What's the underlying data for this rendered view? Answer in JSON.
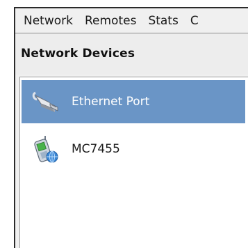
{
  "menubar": {
    "items": [
      {
        "label": "Network"
      },
      {
        "label": "Remotes"
      },
      {
        "label": "Stats"
      },
      {
        "label": "C"
      }
    ]
  },
  "panel": {
    "title": "Network Devices"
  },
  "devices": [
    {
      "label": "Ethernet Port",
      "icon": "ethernet-port-icon",
      "selected": true
    },
    {
      "label": "MC7455",
      "icon": "wireless-modem-icon",
      "selected": false
    }
  ],
  "colors": {
    "selection": "#6a95c6",
    "menubar_bg": "#f0f0f0",
    "list_bg": "#ffffff"
  }
}
